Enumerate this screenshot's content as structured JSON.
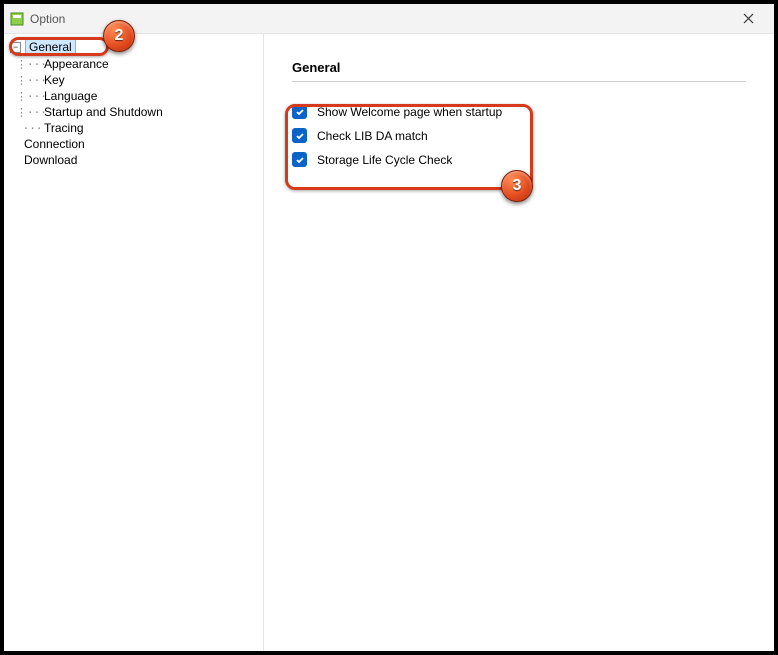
{
  "window": {
    "title": "Option"
  },
  "tree": {
    "general": "General",
    "children": {
      "appearance": "Appearance",
      "key": "Key",
      "language": "Language",
      "startup": "Startup and Shutdown",
      "tracing": "Tracing"
    },
    "connection": "Connection",
    "download": "Download"
  },
  "panel": {
    "heading": "General",
    "opts": {
      "welcome": "Show Welcome page when startup",
      "libda": "Check LIB DA match",
      "storage": "Storage Life Cycle Check"
    }
  },
  "callouts": {
    "two": "2",
    "three": "3"
  }
}
